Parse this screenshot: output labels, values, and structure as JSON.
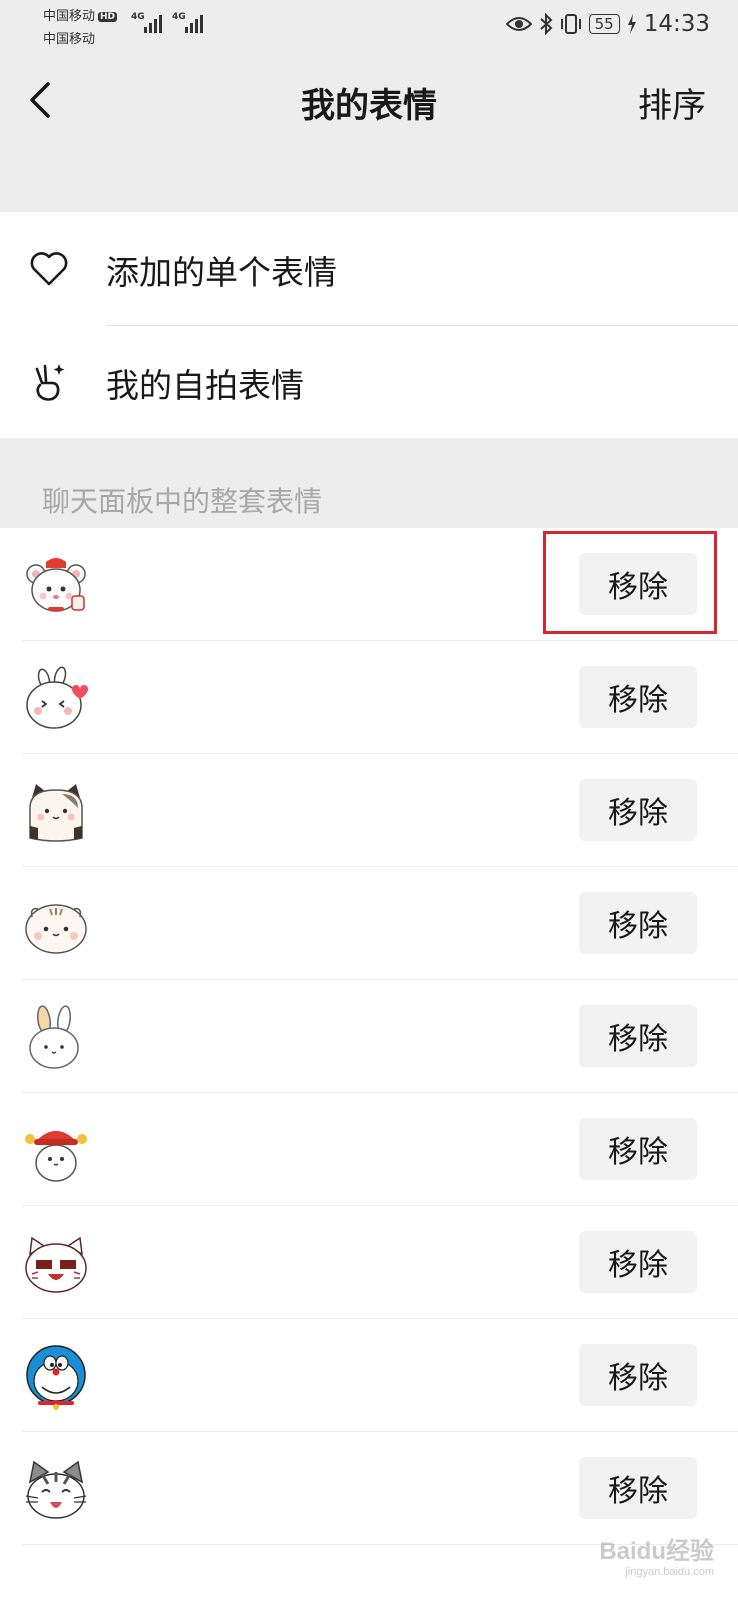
{
  "status_bar": {
    "carrier1": "中国移动",
    "carrier1_badge": "HD",
    "carrier2": "中国移动",
    "network1": "4G",
    "network2": "4G",
    "battery": "55",
    "time": "14:33"
  },
  "nav": {
    "title": "我的表情",
    "sort_label": "排序"
  },
  "menu": {
    "items": [
      {
        "label": "添加的单个表情",
        "icon": "heart-icon"
      },
      {
        "label": "我的自拍表情",
        "icon": "selfie-hand-icon"
      }
    ]
  },
  "section": {
    "title": "聊天面板中的整套表情"
  },
  "stickers": [
    {
      "icon": "bear-sticker-icon",
      "remove_label": "移除"
    },
    {
      "icon": "bunny-heart-sticker-icon",
      "remove_label": "移除"
    },
    {
      "icon": "panda-cat-sticker-icon",
      "remove_label": "移除"
    },
    {
      "icon": "hamster-sticker-icon",
      "remove_label": "移除"
    },
    {
      "icon": "rabbit-sticker-icon",
      "remove_label": "移除"
    },
    {
      "icon": "fortune-hat-sticker-icon",
      "remove_label": "移除"
    },
    {
      "icon": "laughing-cat-sticker-icon",
      "remove_label": "移除"
    },
    {
      "icon": "doraemon-sticker-icon",
      "remove_label": "移除"
    },
    {
      "icon": "kitten-sticker-icon",
      "remove_label": "移除"
    }
  ],
  "watermark": {
    "brand": "Baidu经验",
    "url": "jingyan.baidu.com"
  },
  "colors": {
    "background": "#ededed",
    "highlight": "#d8262e",
    "button_bg": "#f2f2f2"
  }
}
